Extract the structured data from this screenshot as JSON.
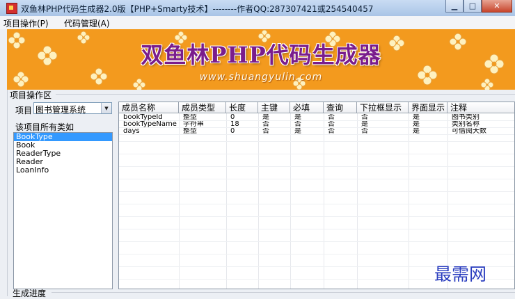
{
  "window": {
    "title": "双鱼林PHP代码生成器2.0版【PHP+Smarty技术】--------作者QQ:287307421或254540457"
  },
  "menu": {
    "items": [
      "项目操作(P)",
      "代码管理(A)"
    ]
  },
  "banner": {
    "title": "双鱼林PHP代码生成器",
    "url": "www.shuangyulin.com"
  },
  "project_area": {
    "label": "项目操作区",
    "project_label": "项目",
    "project_selected": "图书管理系统",
    "classes_label": "该项目所有类如",
    "classes": [
      "BookType",
      "Book",
      "ReaderType",
      "Reader",
      "LoanInfo"
    ],
    "selected_class": "BookType"
  },
  "table": {
    "columns": [
      "成员名称",
      "成员类型",
      "长度",
      "主键",
      "必填",
      "查询",
      "下拉框显示",
      "界面显示",
      "注释"
    ],
    "rows": [
      [
        "bookTypeId",
        "整型",
        "0",
        "是",
        "是",
        "否",
        "否",
        "是",
        "图书类别"
      ],
      [
        "bookTypeName",
        "字符串",
        "18",
        "否",
        "否",
        "否",
        "是",
        "是",
        "类别名称"
      ],
      [
        "days",
        "整型",
        "0",
        "否",
        "是",
        "否",
        "否",
        "是",
        "可借阅天数"
      ]
    ]
  },
  "watermark": "最需网",
  "progress": {
    "label": "生成进度"
  },
  "colors": {
    "banner_orange": "#f39a1e",
    "banner_title": "#7a1d8c",
    "selection": "#3399ff",
    "watermark": "#2a3dbf"
  }
}
